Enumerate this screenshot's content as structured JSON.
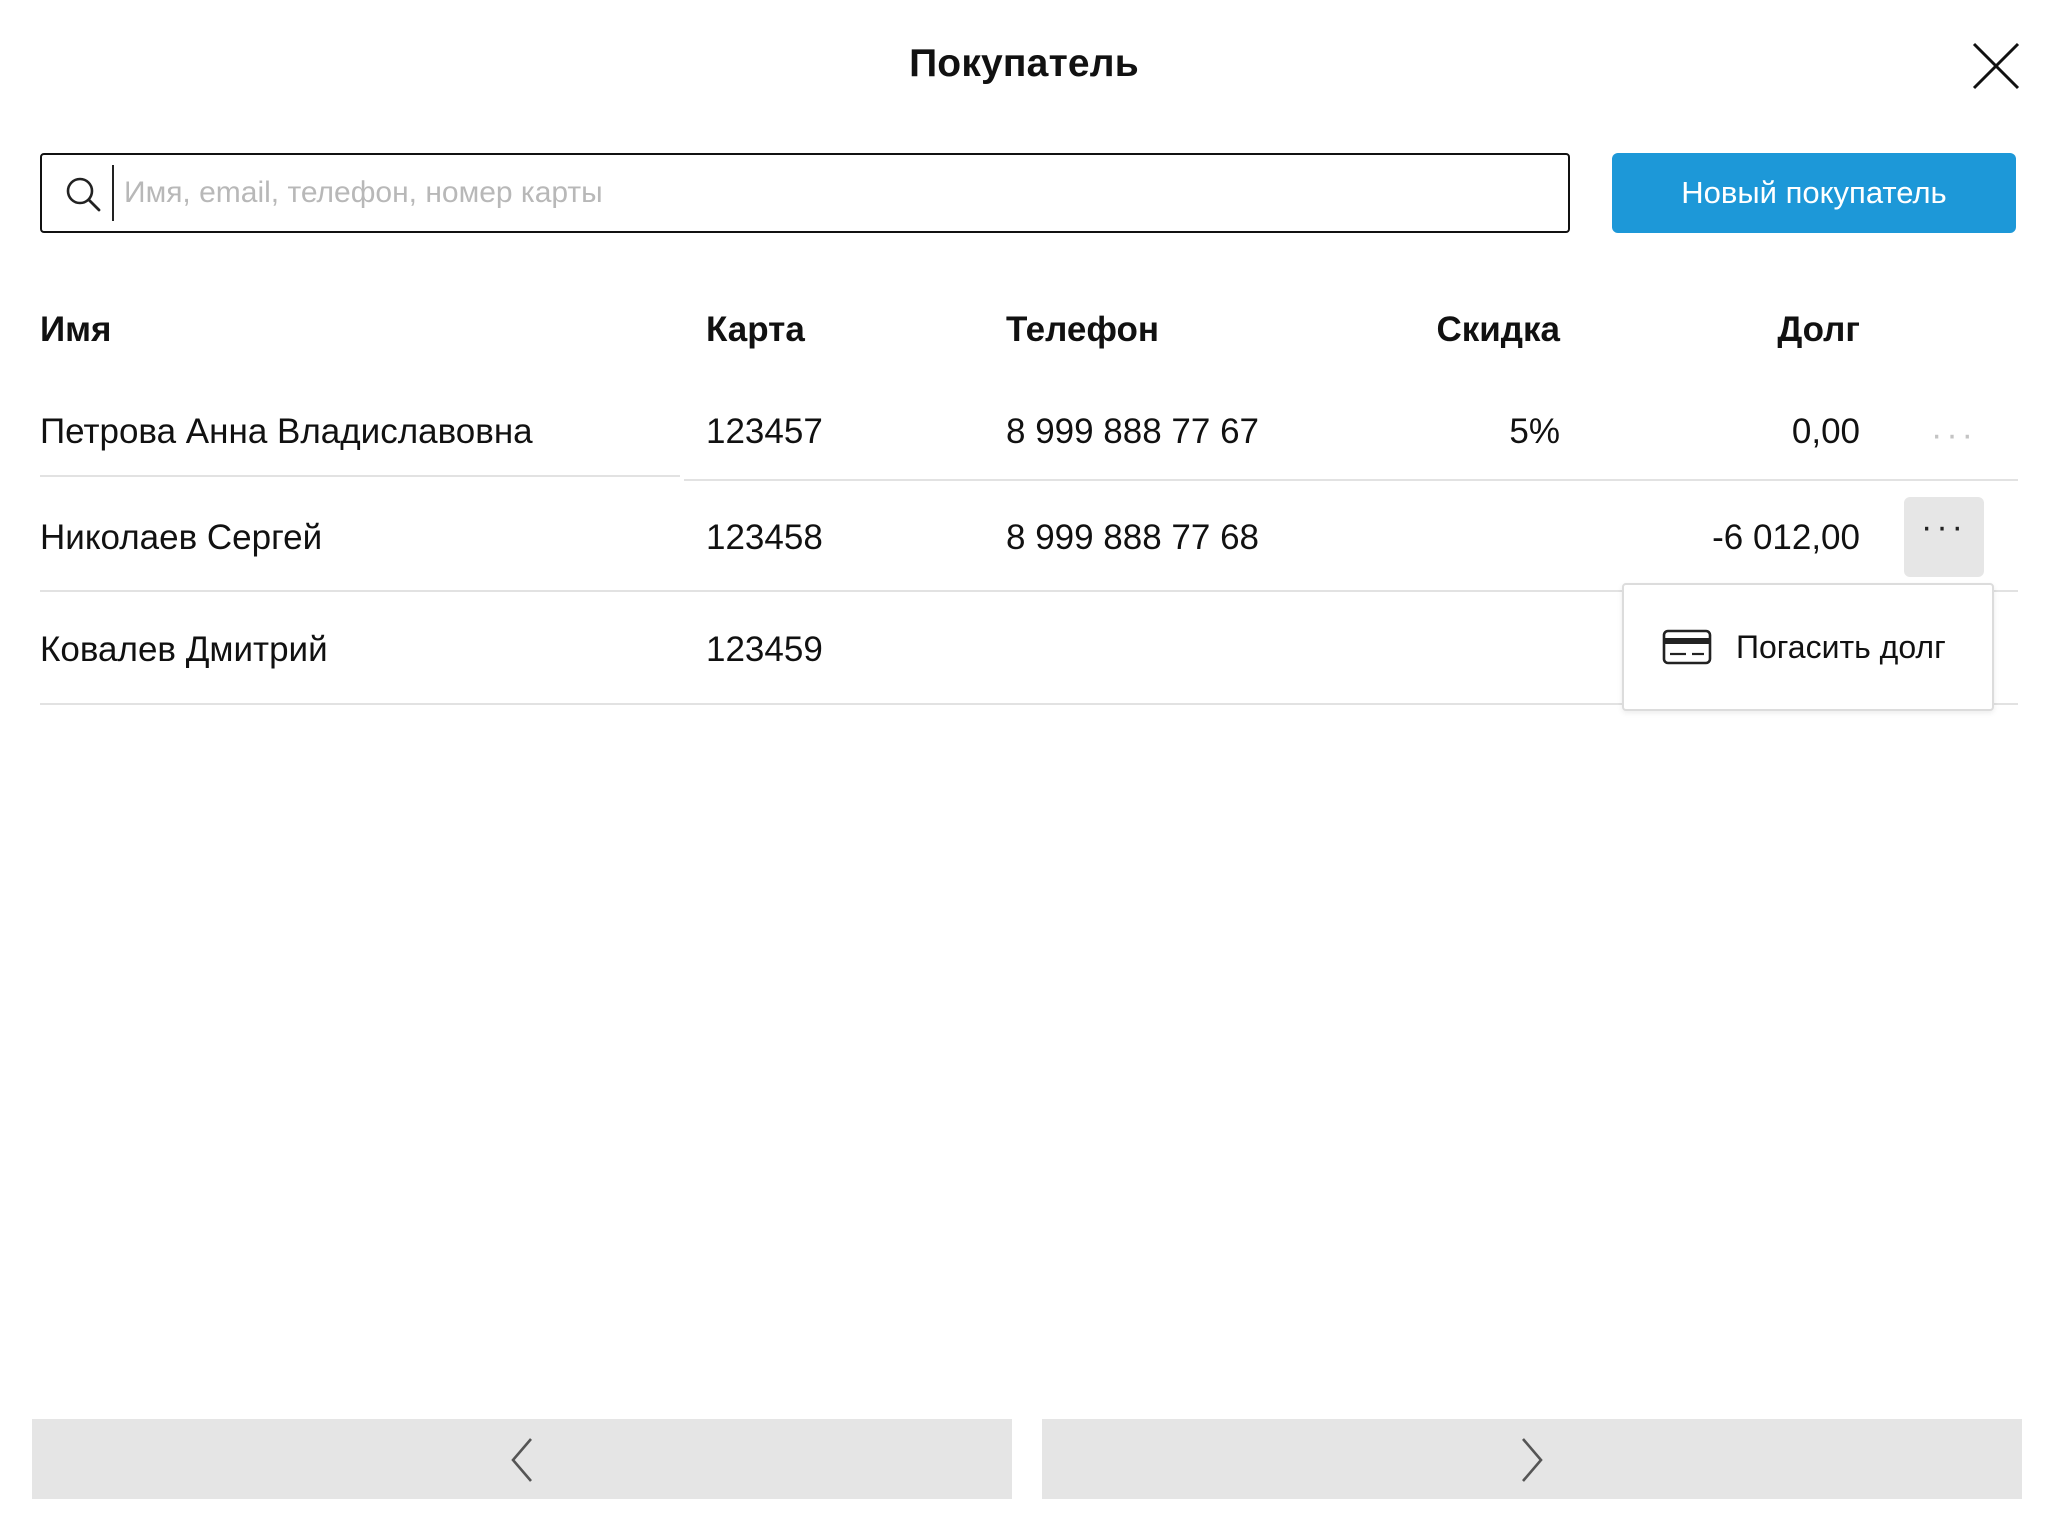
{
  "header": {
    "title": "Покупатель",
    "close_icon": "close-icon"
  },
  "search": {
    "placeholder": "Имя, email, телефон, номер карты",
    "value": "",
    "icon": "search-icon"
  },
  "new_customer_button": {
    "label": "Новый покупатель",
    "color": "#1d98d8"
  },
  "table": {
    "columns": [
      "Имя",
      "Карта",
      "Телефон",
      "Скидка",
      "Долг"
    ],
    "rows": [
      {
        "name": "Петрова Анна Владиславовна",
        "card": "123457",
        "phone": "8 999 888 77 67",
        "discount": "5%",
        "debt": "0,00"
      },
      {
        "name": "Николаев Сергей",
        "card": "123458",
        "phone": "8 999 888 77 68",
        "discount": "",
        "debt": "-6 012,00"
      },
      {
        "name": "Ковалев Дмитрий",
        "card": "123459",
        "phone": "",
        "discount": "",
        "debt": ""
      }
    ],
    "more_label": "···"
  },
  "row_menu": {
    "items": [
      {
        "label": "Погасить долг",
        "icon": "credit-card-icon"
      }
    ]
  },
  "pagination": {
    "prev_icon": "chevron-left-icon",
    "next_icon": "chevron-right-icon"
  }
}
